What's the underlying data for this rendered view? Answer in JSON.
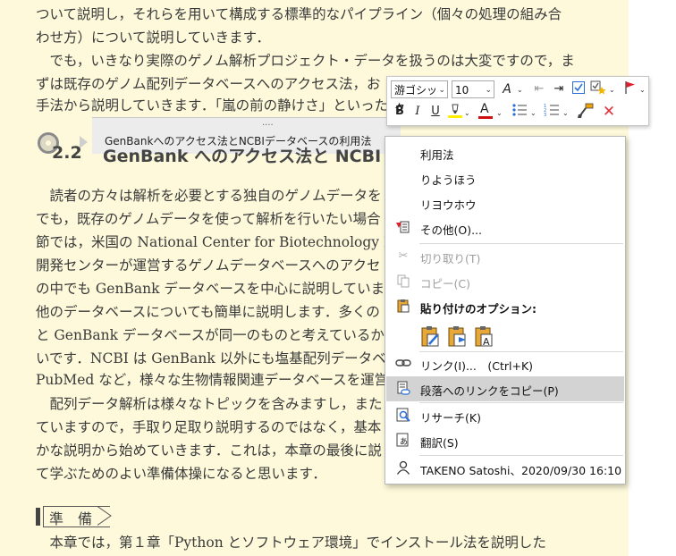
{
  "document": {
    "lines": [
      "ついて説明し，それらを用いて構成する標準的なパイプライン（個々の処理の組み合",
      "わせ方）について説明していきます．",
      "　でも，いきなり実際のゲノム解析プロジェクト・データを扱うのは大変ですので，ま",
      "ずは既存のゲノム配列データベースへのアクセス法，お",
      "手法から説明していきます．「嵐の前の静けさ」といった"
    ],
    "section_number": "2.2",
    "section_title": "GenBank へのアクセス法と NCBI デ",
    "body_lines": [
      "　読者の方々は解析を必要とする独自のゲノムデータを",
      "でも，既存のゲノムデータを使って解析を行いたい場合",
      "節では，米国の National Center for Biotechnology Info",
      "開発センターが運営するゲノムデータベースへのアクセ",
      "の中でも GenBank データベースを中心に説明していま",
      "他のデータベースについても簡単に説明します．多くの",
      "と GenBank データベースが同一のものと考えているか",
      "いです．NCBI は GenBank 以外にも塩基配列データベ",
      "PubMed など，様々な生物情報関連データベースを運営",
      "　配列データ解析は様々なトピックを含みますし，また",
      "ていますので，手取り足取り説明するのではなく，基本",
      "かな説明から始めていきます．これは，本章の最後に説",
      "て学ぶためのよい準備体操になると思います．"
    ],
    "heading_junbi": "準　備",
    "last_line": "　本章では，第１章「Python とソフトウェア環境」でインストール法を説明した"
  },
  "nav_pane": {
    "grip": "....",
    "text": "GenBankへのアクセス法とNCBIデータベースの利用法"
  },
  "mini_toolbar": {
    "font_name": "游ゴシック",
    "font_size": "10",
    "bold": "B",
    "italic": "I",
    "underline": "U",
    "font_color_letter": "A",
    "highlight_color": "#ffee00",
    "font_color": "#d01010"
  },
  "context_menu": {
    "items": [
      {
        "label": "利用法",
        "icon": ""
      },
      {
        "label": "りようほう",
        "icon": ""
      },
      {
        "label": "リヨウホウ",
        "icon": ""
      },
      {
        "label": "その他(O)...",
        "icon": "spelling-icon"
      },
      {
        "label": "切り取り(T)",
        "icon": "scissors-icon",
        "disabled": true
      },
      {
        "label": "コピー(C)",
        "icon": "copy-icon",
        "disabled": true
      },
      {
        "label": "貼り付けのオプション:",
        "icon": "clipboard-icon",
        "bold": true
      },
      {
        "label": "リンク(I)...　(Ctrl+K)",
        "icon": "link-icon"
      },
      {
        "label": "段落へのリンクをコピー(P)",
        "icon": "paragraph-link-icon",
        "highlighted": true
      },
      {
        "label": "リサーチ(K)",
        "icon": "research-icon"
      },
      {
        "label": "翻訳(S)",
        "icon": "translate-icon"
      },
      {
        "label": "TAKENO Satoshi、2020/09/30 16:10",
        "icon": "person-icon"
      }
    ],
    "paste_options": [
      "paste-keep-formatting-icon",
      "paste-merge-formatting-icon",
      "paste-text-only-icon"
    ]
  }
}
